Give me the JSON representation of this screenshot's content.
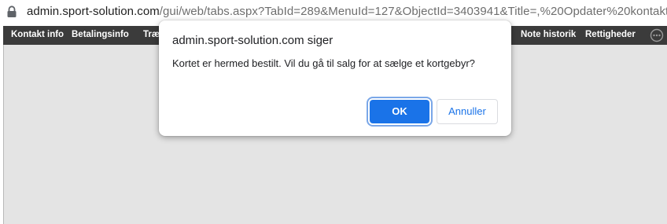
{
  "browser": {
    "url_host": "admin.sport-solution.com",
    "url_path": "/gui/web/tabs.aspx?TabId=289&MenuId=127&ObjectId=3403941&Title=,%20Opdater%20kontakt,%2..."
  },
  "tabs": {
    "items": [
      {
        "label": "Kontakt info"
      },
      {
        "label": "Betalingsinfo"
      },
      {
        "label": "Træ"
      },
      {
        "label": "Note historik"
      },
      {
        "label": "Rettigheder"
      }
    ]
  },
  "dialog": {
    "title": "admin.sport-solution.com siger",
    "message": "Kortet er hermed bestilt. Vil du gå til salg for at sælge et kortgebyr?",
    "ok_label": "OK",
    "cancel_label": "Annuller"
  },
  "colors": {
    "accent": "#1a73e8",
    "tabbar": "#3b3b3b",
    "content_bg": "#e4e4e4"
  },
  "icons": {
    "address_bar": "lock-icon",
    "tabbar_right": "more-options-icon"
  }
}
